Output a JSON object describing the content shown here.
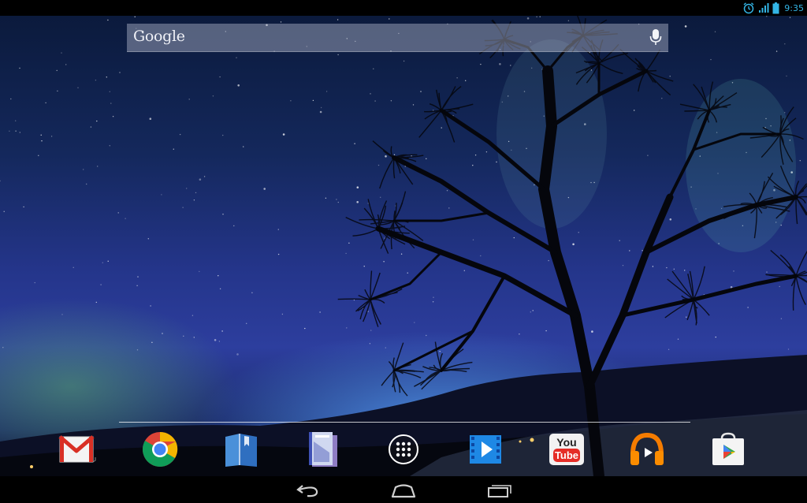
{
  "status_bar": {
    "time": "9:35",
    "icons": [
      "alarm-icon",
      "signal-icon",
      "battery-icon"
    ],
    "accent_color": "#33b5e5"
  },
  "search_bar": {
    "logo_text": "Google",
    "icon": "mic-icon"
  },
  "dock": {
    "apps": [
      {
        "name": "Gmail",
        "icon": "gmail-icon"
      },
      {
        "name": "Chrome",
        "icon": "chrome-icon"
      },
      {
        "name": "Play Books",
        "icon": "books-icon"
      },
      {
        "name": "Play Magazines",
        "icon": "magazines-icon"
      },
      {
        "name": "Apps",
        "icon": "app-drawer-icon"
      },
      {
        "name": "Play Movies",
        "icon": "movies-icon"
      },
      {
        "name": "YouTube",
        "icon": "youtube-icon",
        "label_top": "You",
        "label_bottom": "Tube"
      },
      {
        "name": "Play Music",
        "icon": "music-icon"
      },
      {
        "name": "Play Store",
        "icon": "play-store-icon"
      }
    ]
  },
  "nav_bar": {
    "buttons": [
      "back-icon",
      "home-icon",
      "recents-icon"
    ]
  },
  "wallpaper": {
    "subject": "night sky with stars and aurora behind bare tree"
  }
}
